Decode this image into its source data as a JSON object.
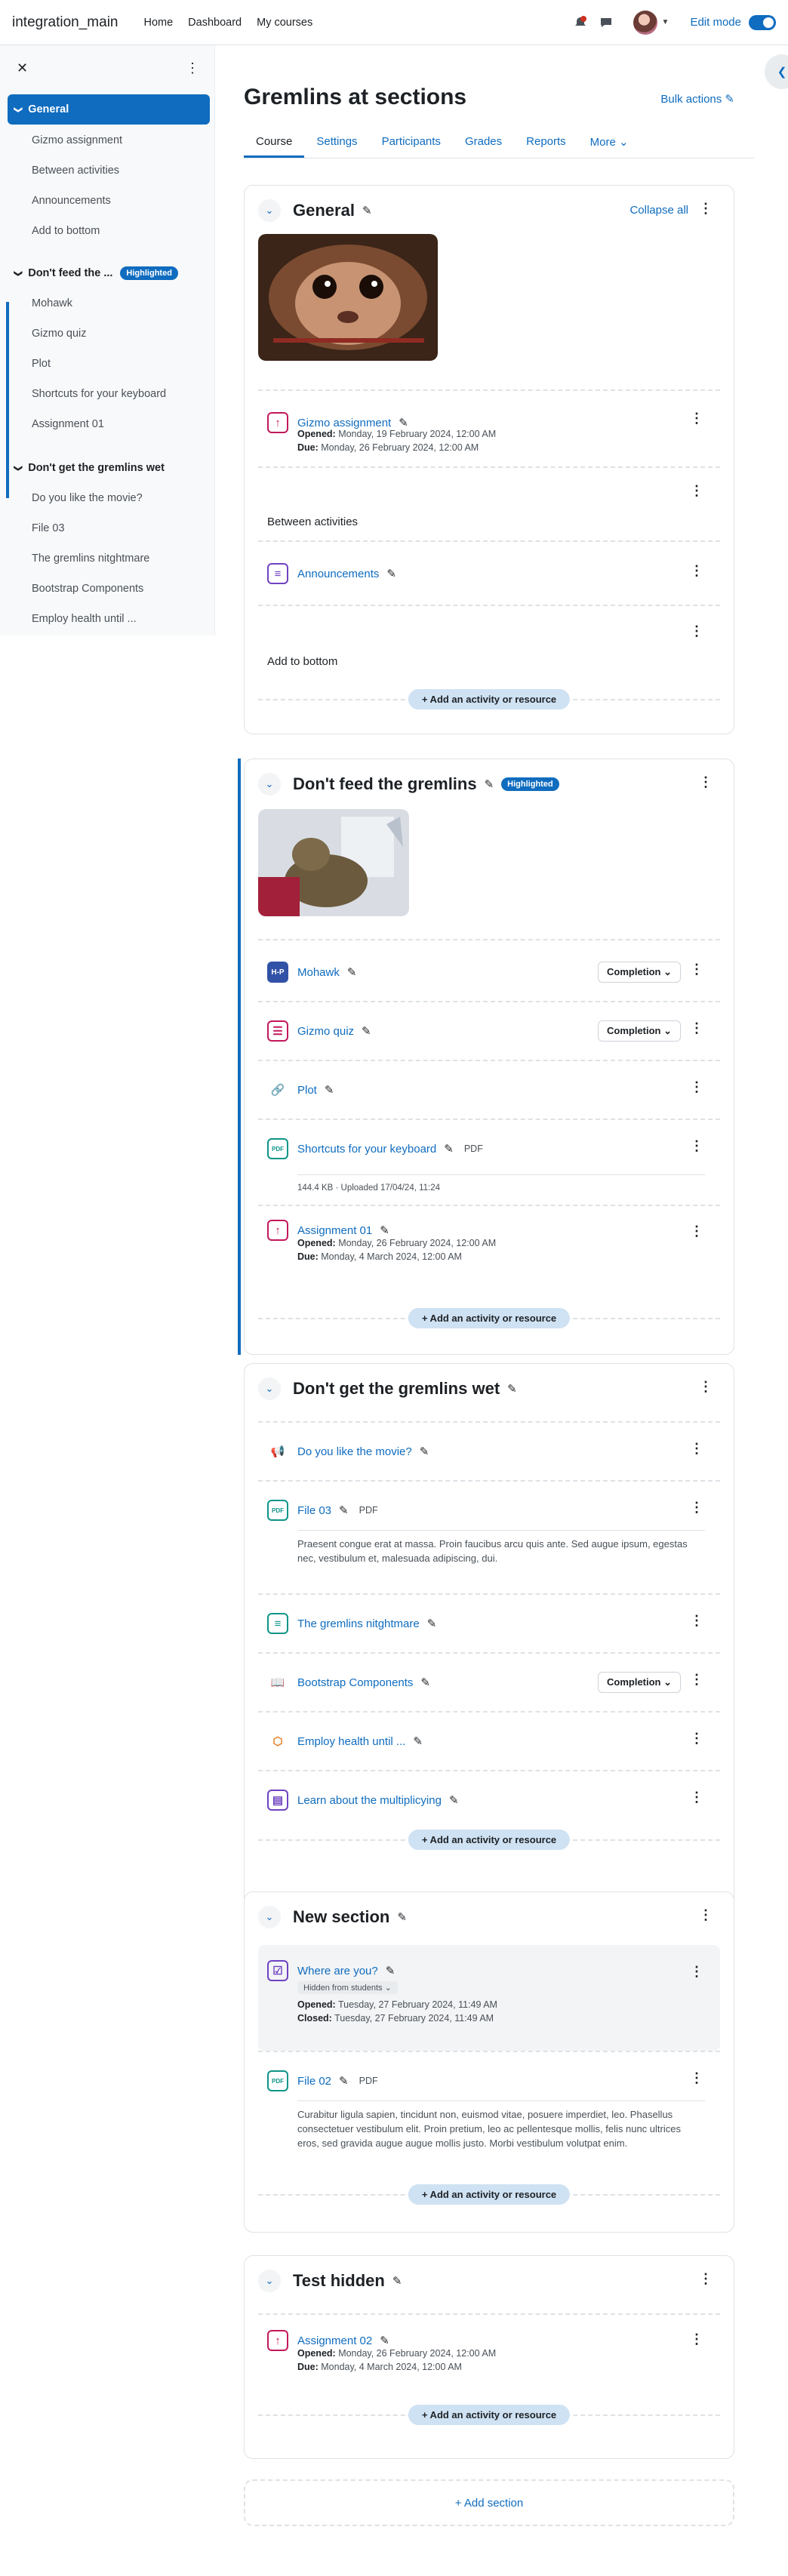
{
  "nav": {
    "brand": "integration_main",
    "links": [
      "Home",
      "Dashboard",
      "My courses"
    ],
    "edit_mode": "Edit mode"
  },
  "drawer": {
    "close": "✕",
    "more": "⋮",
    "sections": [
      {
        "title": "General",
        "items": [
          "Gizmo assignment",
          "Between activities",
          "Announcements",
          "Add to bottom"
        ]
      },
      {
        "title": "Don't feed the ...",
        "badge": "Highlighted",
        "items": [
          "Mohawk",
          "Gizmo quiz",
          "Plot",
          "Shortcuts for your keyboard",
          "Assignment 01"
        ]
      },
      {
        "title": "Don't get the gremlins wet",
        "items": [
          "Do you like the movie?",
          "File 03",
          "The gremlins nitghtmare",
          "Bootstrap Components",
          "Employ health until ..."
        ]
      }
    ]
  },
  "page": {
    "title": "Gremlins at sections",
    "bulk": "Bulk actions",
    "tabs": [
      "Course",
      "Settings",
      "Participants",
      "Grades",
      "Reports",
      "More"
    ]
  },
  "common": {
    "add_activity": "+ Add an activity or resource",
    "completion": "Completion ⌄",
    "collapse_all": "Collapse all",
    "add_section": "+ Add section",
    "pdf": "PDF",
    "opened": "Opened:",
    "due": "Due:",
    "closed": "Closed:"
  },
  "sections": [
    {
      "title": "General",
      "a1": {
        "name": "Gizmo assignment",
        "opened": "Monday, 19 February 2024, 12:00 AM",
        "due": "Monday, 26 February 2024, 12:00 AM"
      },
      "label1": "Between activities",
      "a2": {
        "name": "Announcements"
      },
      "label2": "Add to bottom"
    },
    {
      "title": "Don't feed the gremlins",
      "badge": "Highlighted",
      "a1": {
        "name": "Mohawk"
      },
      "a2": {
        "name": "Gizmo quiz"
      },
      "a3": {
        "name": "Plot"
      },
      "a4": {
        "name": "Shortcuts for your keyboard",
        "info": "144.4 KB · Uploaded 17/04/24, 11:24"
      },
      "a5": {
        "name": "Assignment 01",
        "opened": "Monday, 26 February 2024, 12:00 AM",
        "due": "Monday, 4 March 2024, 12:00 AM"
      }
    },
    {
      "title": "Don't get the gremlins wet",
      "a1": {
        "name": "Do you like the movie?"
      },
      "a2": {
        "name": "File 03",
        "desc": "Praesent congue erat at massa. Proin faucibus arcu quis ante. Sed augue ipsum, egestas nec, vestibulum et, malesuada adipiscing, dui."
      },
      "a3": {
        "name": "The gremlins nitghtmare"
      },
      "a4": {
        "name": "Bootstrap Components"
      },
      "a5": {
        "name": "Employ health until ..."
      },
      "a6": {
        "name": "Learn about the multiplicying"
      }
    },
    {
      "title": "New section",
      "a1": {
        "name": "Where are you?",
        "hidden": "Hidden from students ⌄",
        "opened": "Tuesday, 27 February 2024, 11:49 AM",
        "closed": "Tuesday, 27 February 2024, 11:49 AM"
      },
      "a2": {
        "name": "File 02",
        "desc": "Curabitur ligula sapien, tincidunt non, euismod vitae, posuere imperdiet, leo. Phasellus consectetuer vestibulum elit. Proin pretium, leo ac pellentesque mollis, felis nunc ultrices eros, sed gravida augue augue mollis justo. Morbi vestibulum volutpat enim."
      }
    },
    {
      "title": "Test hidden",
      "a1": {
        "name": "Assignment 02",
        "opened": "Monday, 26 February 2024, 12:00 AM",
        "due": "Monday, 4 March 2024, 12:00 AM"
      }
    }
  ]
}
